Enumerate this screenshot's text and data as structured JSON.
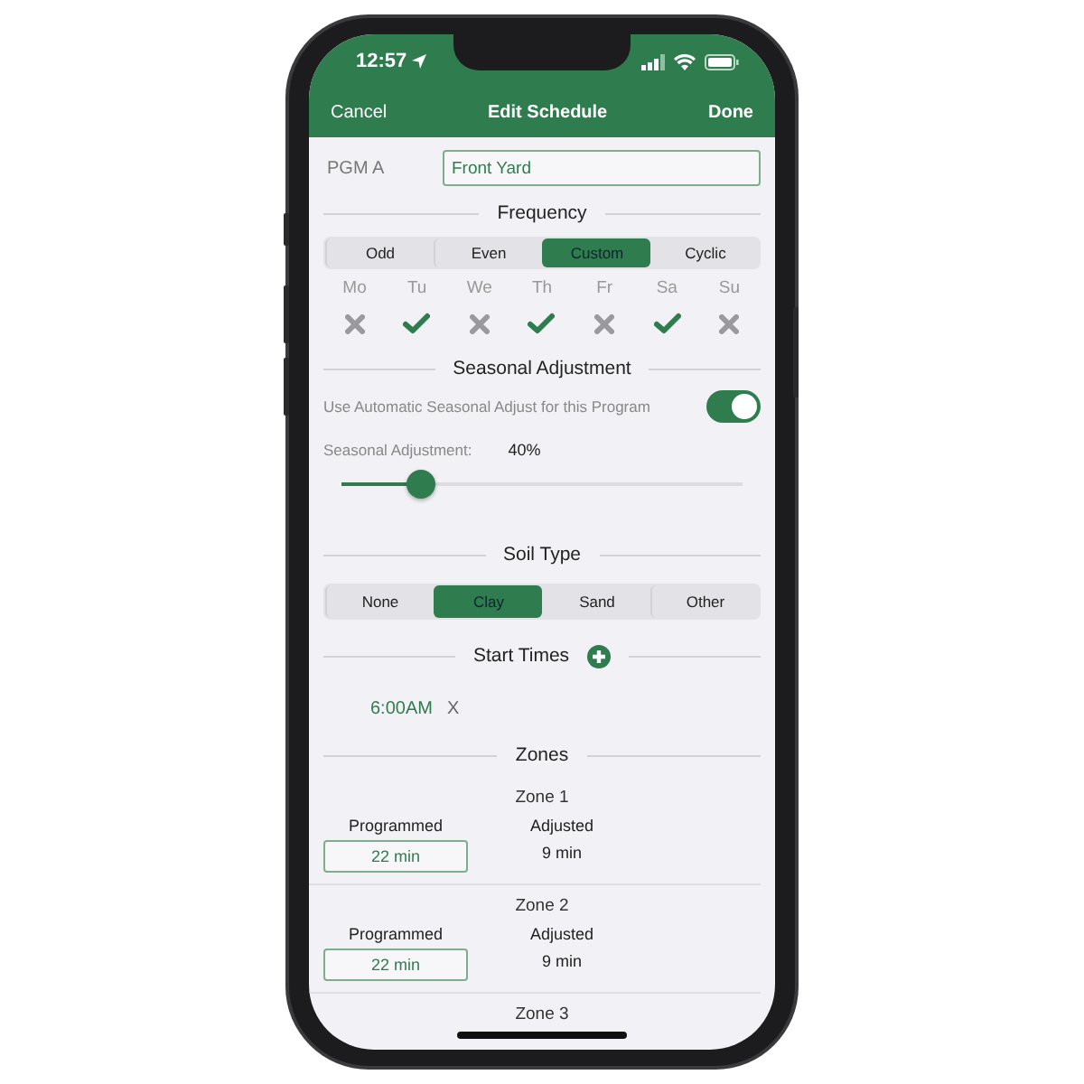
{
  "status_bar": {
    "time": "12:57"
  },
  "nav": {
    "cancel": "Cancel",
    "title": "Edit Schedule",
    "done": "Done"
  },
  "program": {
    "label": "PGM A",
    "name": "Front Yard"
  },
  "frequency": {
    "heading": "Frequency",
    "options": [
      {
        "label": "Odd",
        "selected": false
      },
      {
        "label": "Even",
        "selected": false
      },
      {
        "label": "Custom",
        "selected": true
      },
      {
        "label": "Cyclic",
        "selected": false
      }
    ],
    "days": [
      {
        "label": "Mo",
        "on": false
      },
      {
        "label": "Tu",
        "on": true
      },
      {
        "label": "We",
        "on": false
      },
      {
        "label": "Th",
        "on": true
      },
      {
        "label": "Fr",
        "on": false
      },
      {
        "label": "Sa",
        "on": true
      },
      {
        "label": "Su",
        "on": false
      }
    ]
  },
  "seasonal": {
    "heading": "Seasonal Adjustment",
    "auto_label": "Use Automatic Seasonal Adjust for this Program",
    "auto_on": true,
    "adjust_label": "Seasonal Adjustment:",
    "adjust_value": "40%",
    "level": 0.2
  },
  "soil": {
    "heading": "Soil Type",
    "options": [
      {
        "label": "None",
        "selected": false
      },
      {
        "label": "Clay",
        "selected": true
      },
      {
        "label": "Sand",
        "selected": false
      },
      {
        "label": "Other",
        "selected": false
      }
    ]
  },
  "start_times": {
    "heading": "Start Times",
    "times": [
      {
        "time": "6:00AM",
        "remove": "X"
      }
    ]
  },
  "zones": {
    "heading": "Zones",
    "items": [
      {
        "name": "Zone 1",
        "programmed_label": "Programmed",
        "programmed_value": "22 min",
        "adjusted_label": "Adjusted",
        "adjusted_value": "9 min"
      },
      {
        "name": "Zone 2",
        "programmed_label": "Programmed",
        "programmed_value": "22 min",
        "adjusted_label": "Adjusted",
        "adjusted_value": "9 min"
      },
      {
        "name": "Zone 3"
      }
    ]
  }
}
